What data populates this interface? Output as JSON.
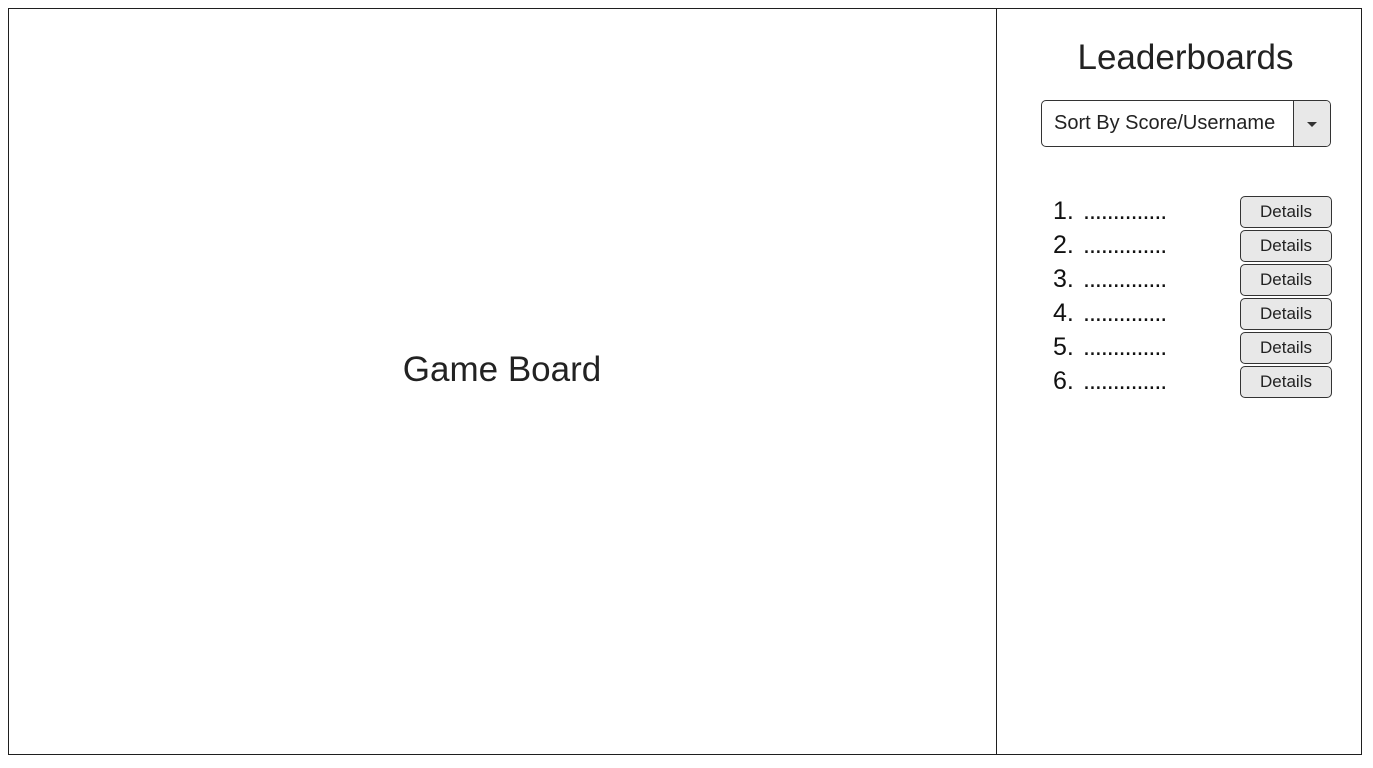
{
  "game_board": {
    "title": "Game Board"
  },
  "leaderboard": {
    "title": "Leaderboards",
    "sort": {
      "selected": "Sort By Score/Username"
    },
    "entries": [
      {
        "rank": "1.",
        "name": "..............",
        "button": "Details"
      },
      {
        "rank": "2.",
        "name": "..............",
        "button": "Details"
      },
      {
        "rank": "3.",
        "name": "..............",
        "button": "Details"
      },
      {
        "rank": "4.",
        "name": "..............",
        "button": "Details"
      },
      {
        "rank": "5.",
        "name": "..............",
        "button": "Details"
      },
      {
        "rank": "6.",
        "name": "..............",
        "button": "Details"
      }
    ]
  },
  "icons": {
    "dropdown": "chevron-down-icon"
  },
  "colors": {
    "border": "#1f1f1f",
    "button_fill": "#e8e8e8",
    "text": "#222222"
  }
}
